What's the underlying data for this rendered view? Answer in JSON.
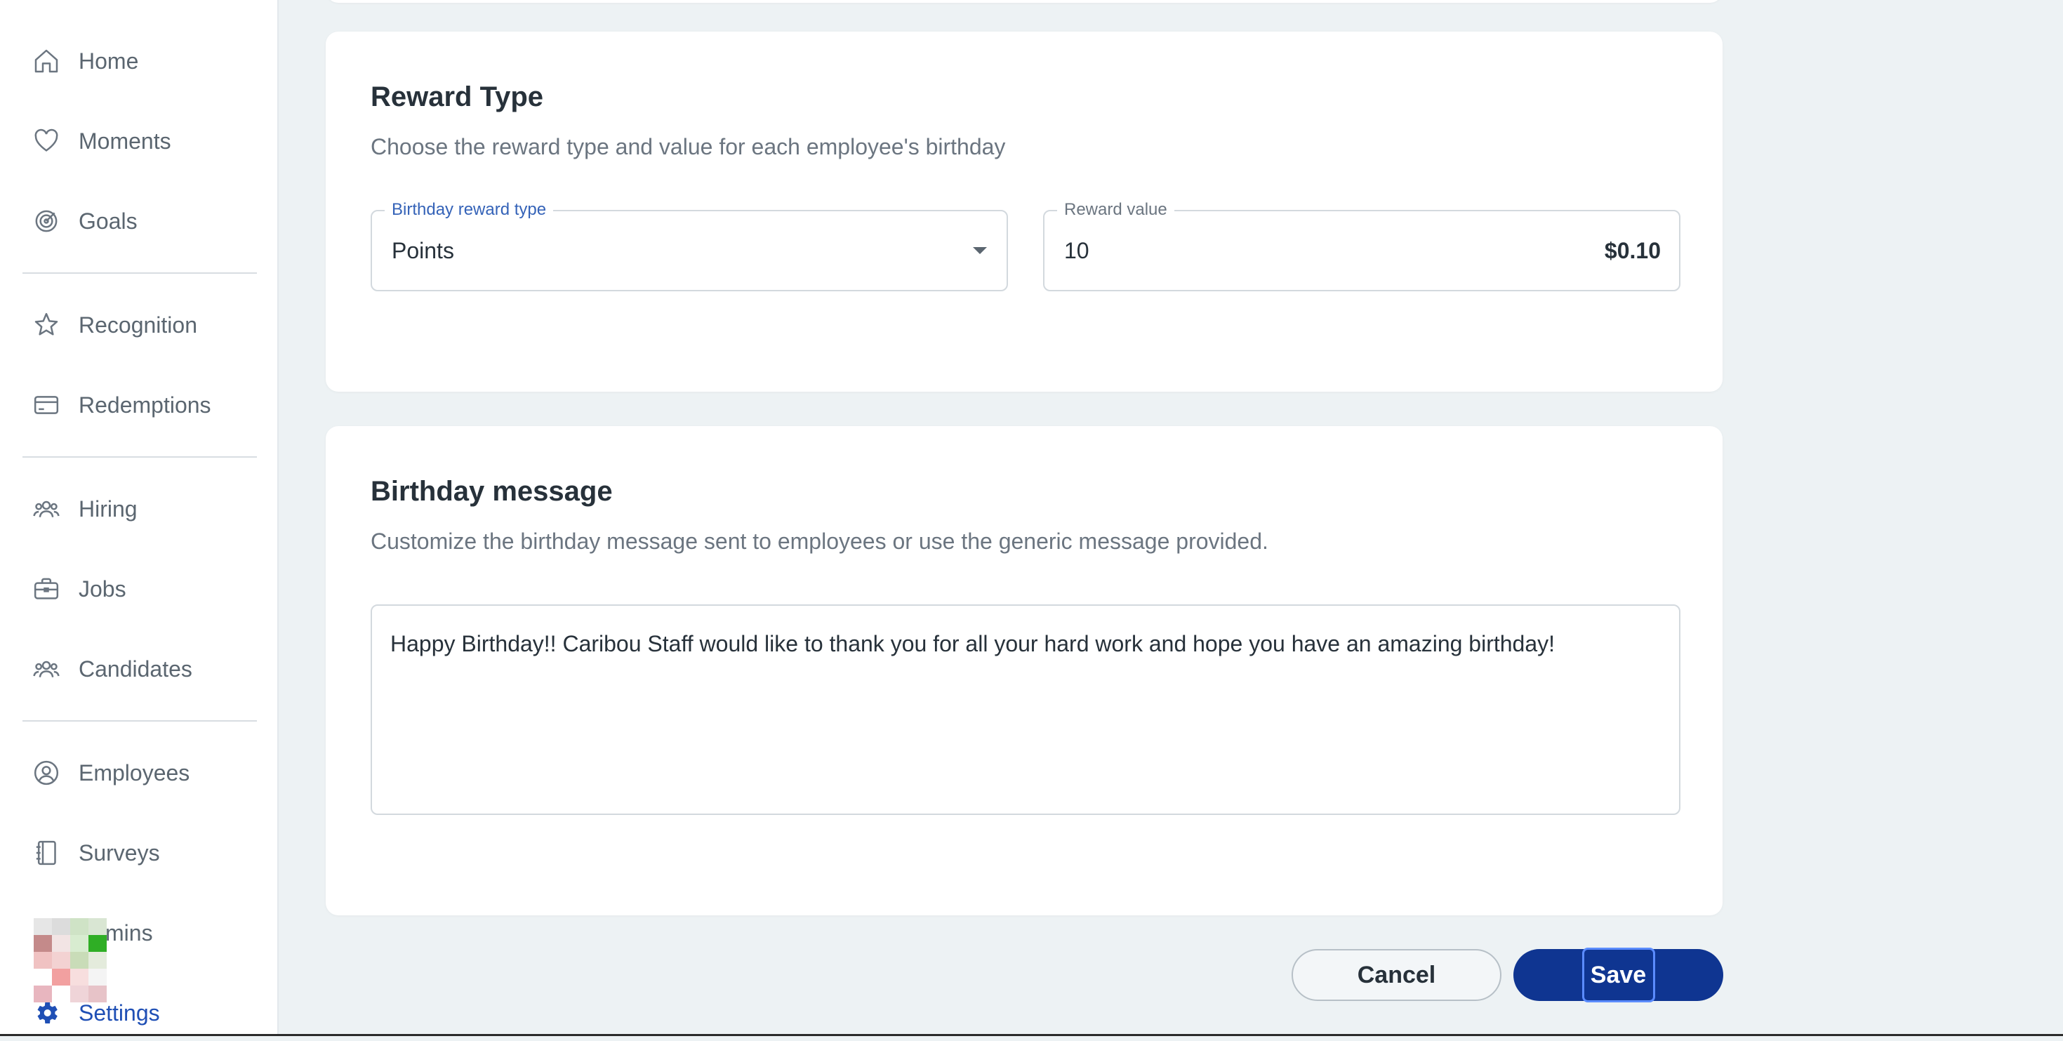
{
  "sidebar": {
    "items": [
      {
        "label": "Home",
        "icon": "home-icon"
      },
      {
        "label": "Moments",
        "icon": "heart-icon"
      },
      {
        "label": "Goals",
        "icon": "target-icon"
      },
      {
        "label": "Recognition",
        "icon": "star-badge-icon"
      },
      {
        "label": "Redemptions",
        "icon": "credit-card-icon"
      },
      {
        "label": "Hiring",
        "icon": "people-icon"
      },
      {
        "label": "Jobs",
        "icon": "briefcase-icon"
      },
      {
        "label": "Candidates",
        "icon": "people-icon"
      },
      {
        "label": "Employees",
        "icon": "user-circle-icon"
      },
      {
        "label": "Surveys",
        "icon": "notebook-icon"
      },
      {
        "label": "mins",
        "icon": "avatar"
      },
      {
        "label": "Settings",
        "icon": "gear-icon",
        "active": true
      }
    ]
  },
  "reward_card": {
    "title": "Reward Type",
    "subtitle": "Choose the reward type and value for each employee's birthday",
    "reward_type_field": {
      "label": "Birthday reward type",
      "value": "Points"
    },
    "reward_value_field": {
      "label": "Reward value",
      "value": "10",
      "suffix": "$0.10"
    }
  },
  "message_card": {
    "title": "Birthday message",
    "subtitle": "Customize the birthday message sent to employees or use the generic message provided.",
    "message": "Happy Birthday!! Caribou Staff would like to thank you for all your hard work and hope you have an amazing birthday!"
  },
  "actions": {
    "cancel_label": "Cancel",
    "save_label": "Save"
  },
  "colors": {
    "accent": "#0f3591",
    "background": "#edf2f4",
    "active_nav": "#1f4fb5"
  }
}
